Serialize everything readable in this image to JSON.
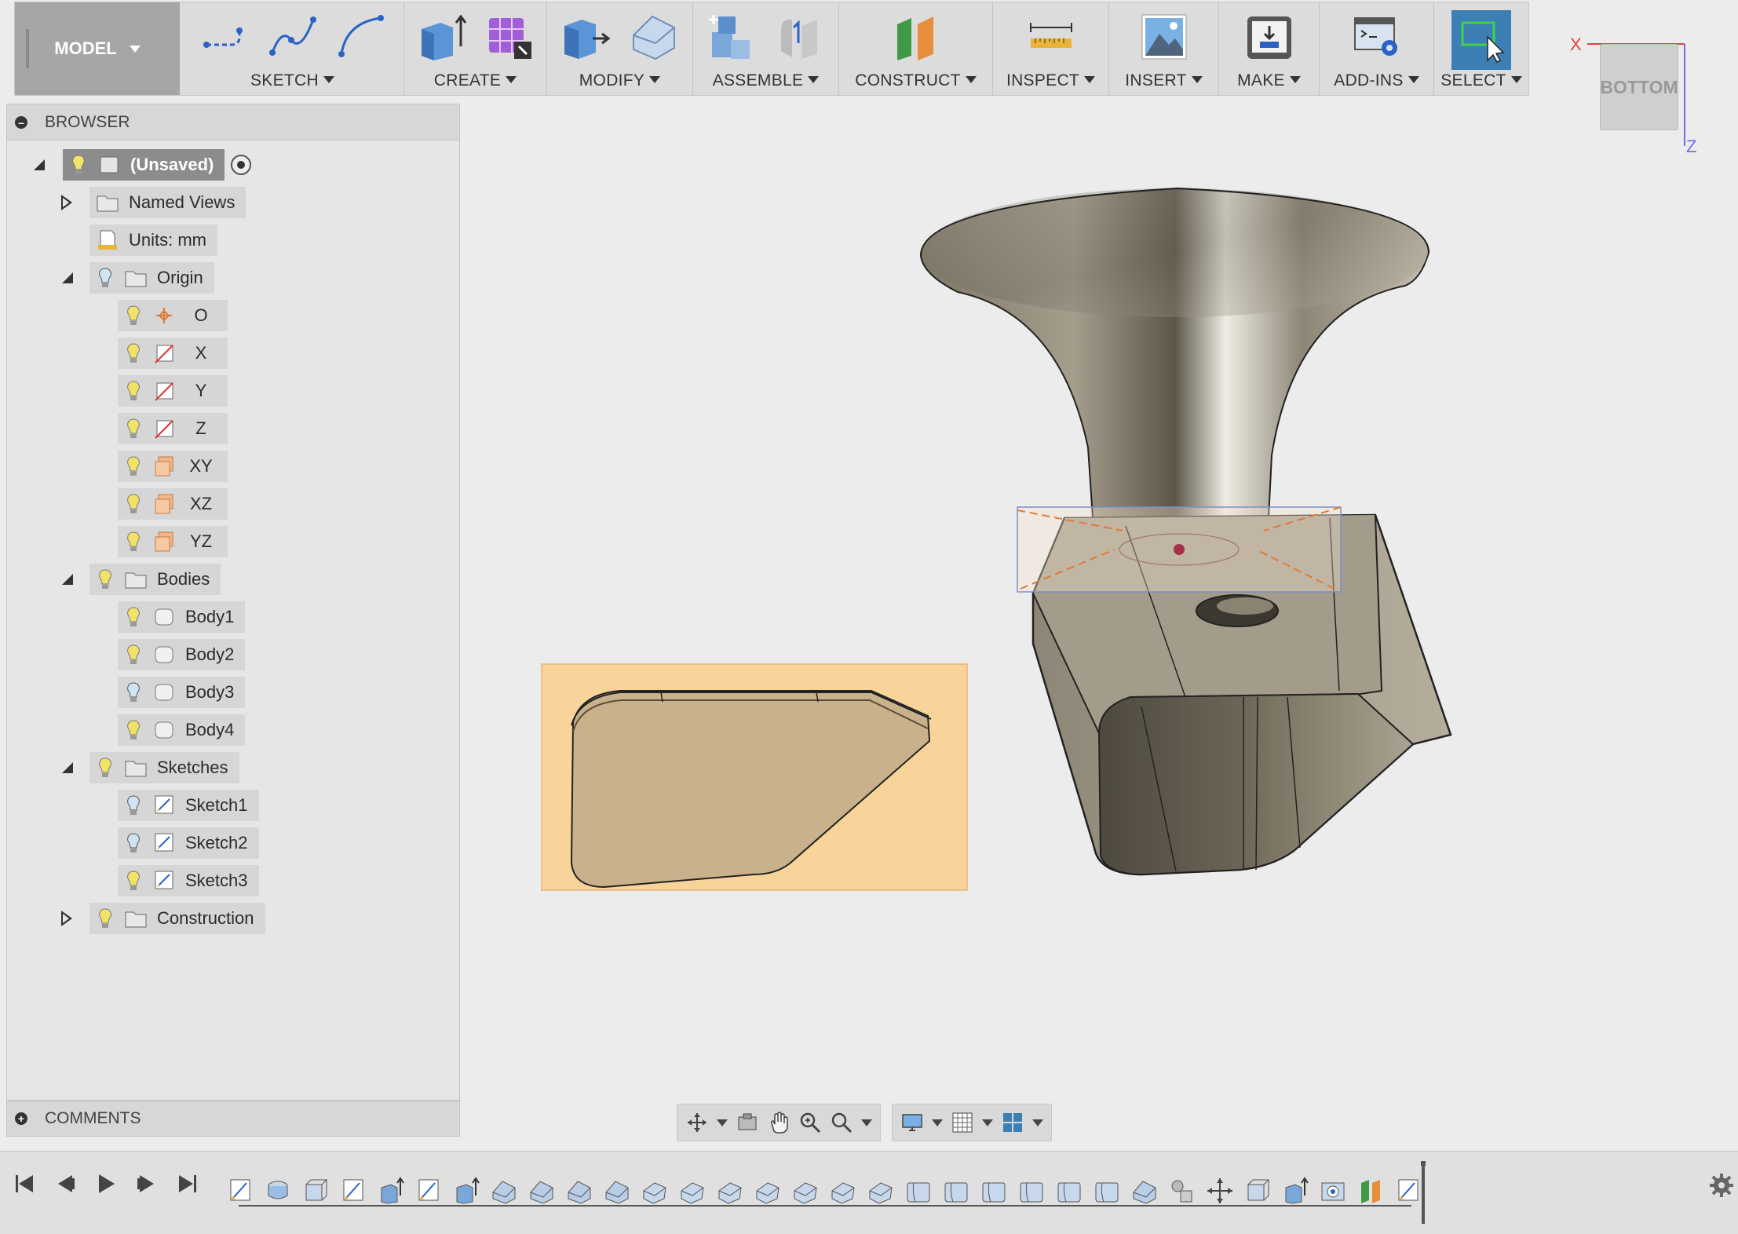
{
  "toolbar": {
    "workspace_label": "MODEL",
    "groups": [
      {
        "label": "SKETCH"
      },
      {
        "label": "CREATE"
      },
      {
        "label": "MODIFY"
      },
      {
        "label": "ASSEMBLE"
      },
      {
        "label": "CONSTRUCT"
      },
      {
        "label": "INSPECT"
      },
      {
        "label": "INSERT"
      },
      {
        "label": "MAKE"
      },
      {
        "label": "ADD-INS"
      },
      {
        "label": "SELECT"
      }
    ]
  },
  "viewcube": {
    "face": "BOTTOM",
    "axis_x": "X",
    "axis_z": "Z"
  },
  "browser": {
    "title": "BROWSER",
    "root": "(Unsaved)",
    "named_views": "Named Views",
    "units": "Units: mm",
    "origin": {
      "label": "Origin",
      "items": [
        "O",
        "X",
        "Y",
        "Z",
        "XY",
        "XZ",
        "YZ"
      ]
    },
    "bodies": {
      "label": "Bodies",
      "items": [
        "Body1",
        "Body2",
        "Body3",
        "Body4"
      ]
    },
    "sketches": {
      "label": "Sketches",
      "items": [
        "Sketch1",
        "Sketch2",
        "Sketch3"
      ]
    },
    "construction": "Construction"
  },
  "comments": {
    "title": "COMMENTS"
  },
  "colors": {
    "accent": "#3b7fb5",
    "sketch_profile": "#f8d39a",
    "body_metal": "#8f8878"
  },
  "timeline": {
    "feature_icons": [
      "sketch-icon",
      "revolve-icon",
      "box-icon",
      "sketch-icon",
      "extrude-icon",
      "sketch-icon",
      "extrude-icon",
      "fillet-icon",
      "fillet-icon",
      "fillet-icon",
      "fillet-icon",
      "chamfer-icon",
      "chamfer-icon",
      "chamfer-icon",
      "chamfer-icon",
      "chamfer-icon",
      "chamfer-icon",
      "chamfer-icon",
      "shell-icon",
      "shell-icon",
      "shell-icon",
      "shell-icon",
      "shell-icon",
      "shell-icon",
      "fillet-icon",
      "joint-icon",
      "move-icon",
      "box-icon",
      "extrude-icon",
      "hole-icon",
      "plane-icon",
      "sketch-icon"
    ]
  }
}
